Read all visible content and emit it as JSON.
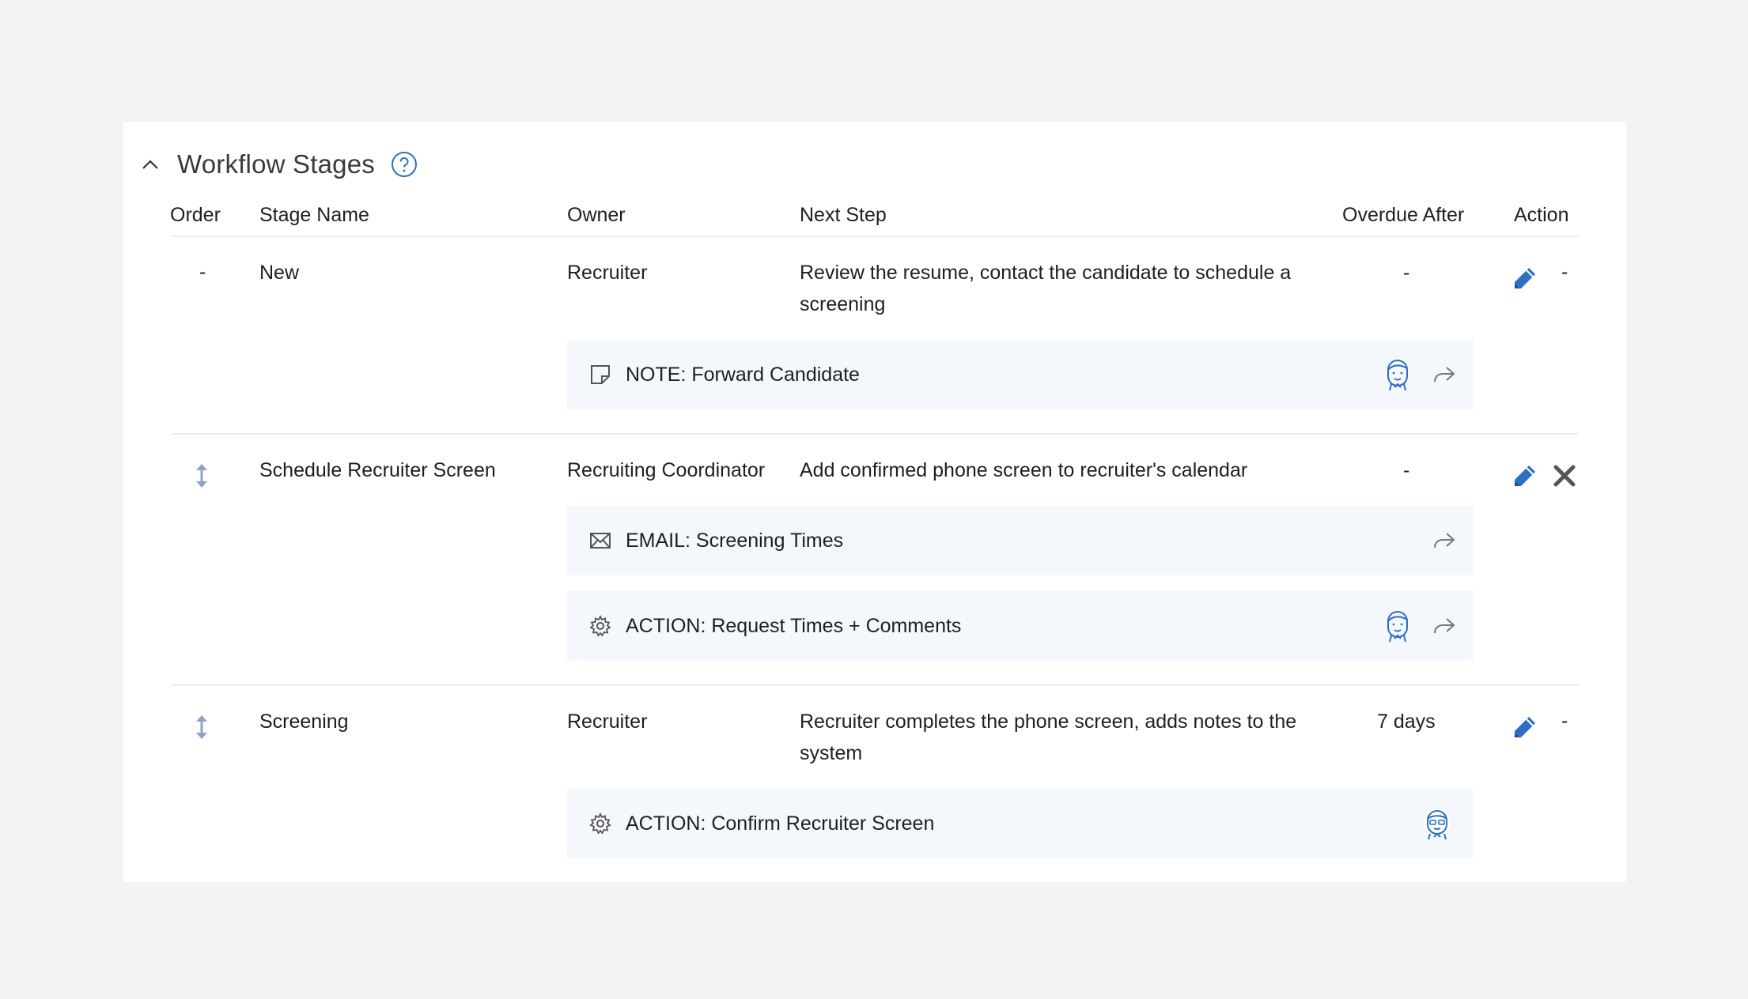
{
  "section": {
    "title": "Workflow Stages"
  },
  "columns": {
    "order": "Order",
    "stage_name": "Stage Name",
    "owner": "Owner",
    "next_step": "Next Step",
    "overdue_after": "Overdue After",
    "action": "Action"
  },
  "rows": [
    {
      "order": "-",
      "stage_name": "New",
      "owner": "Recruiter",
      "next_step": "Review the resume, contact the candidate to schedule a screening",
      "overdue_after": "-",
      "action_secondary": "-",
      "tasks": [
        {
          "icon": "note-icon",
          "label": "NOTE: Forward Candidate",
          "avatar": true,
          "forward": true
        }
      ]
    },
    {
      "order": "",
      "stage_name": "Schedule Recruiter Screen",
      "owner": "Recruiting Coordinator",
      "next_step": "Add confirmed phone screen to recruiter's calendar",
      "overdue_after": "-",
      "action_secondary": "",
      "tasks": [
        {
          "icon": "envelope-icon",
          "label": "EMAIL: Screening Times",
          "avatar": false,
          "forward": true
        },
        {
          "icon": "gear-icon",
          "label": "ACTION: Request Times + Comments",
          "avatar": true,
          "forward": true
        }
      ]
    },
    {
      "order": "",
      "stage_name": "Screening",
      "owner": "Recruiter",
      "next_step": "Recruiter completes the phone screen, adds notes to the system",
      "overdue_after": "7 days",
      "action_secondary": "-",
      "tasks": [
        {
          "icon": "gear-icon",
          "label": "ACTION: Confirm Recruiter Screen",
          "avatar": true,
          "forward": false
        }
      ]
    }
  ],
  "colors": {
    "accent": "#2f6fc1",
    "panel": "#ffffff",
    "background": "#f3f3f3",
    "task_background": "#f4f7fb",
    "delete": "#555555"
  }
}
